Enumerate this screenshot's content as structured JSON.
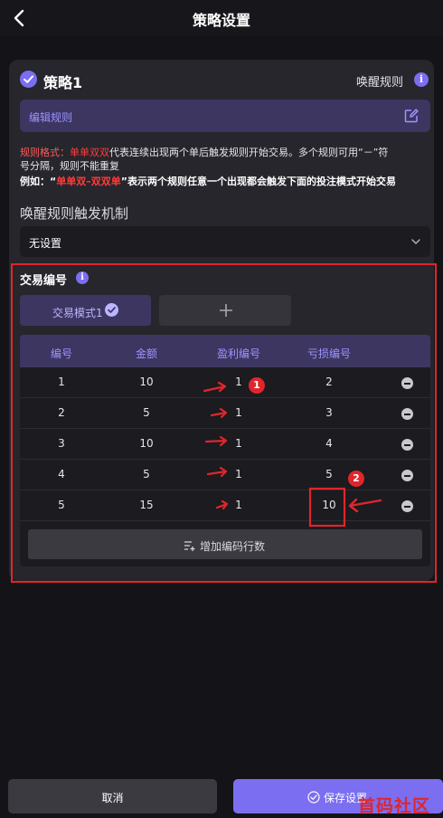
{
  "header": {
    "title": "策略设置",
    "back_icon": "chevron-left-icon"
  },
  "strategy": {
    "name": "策略1",
    "wake_rule_label": "唤醒规则",
    "info_icon": "i",
    "edit_rule_label": "编辑规则"
  },
  "hint": {
    "label": "规则格式：",
    "example_red": "单单双双",
    "line1_rest": "代表连续出现两个单后触发规则开始交易。多个规则可用“－”符",
    "line2": "号分隔，规则不能重复",
    "line3_prefix": "例如：“",
    "line3_red": "单单双–双双单",
    "line3_rest": "”表示两个规则任意一个出现都会触发下面的投注模式开始交易"
  },
  "trigger": {
    "title": "唤醒规则触发机制",
    "selected": "无设置"
  },
  "trade": {
    "title": "交易编号",
    "info_icon": "i",
    "mode_tab_label": "交易模式1",
    "columns": [
      "编号",
      "金额",
      "盈利编号",
      "亏损编号"
    ],
    "rows": [
      {
        "id": "1",
        "amount": "10",
        "profit": "1",
        "loss": "2"
      },
      {
        "id": "2",
        "amount": "5",
        "profit": "1",
        "loss": "3"
      },
      {
        "id": "3",
        "amount": "10",
        "profit": "1",
        "loss": "4"
      },
      {
        "id": "4",
        "amount": "5",
        "profit": "1",
        "loss": "5"
      },
      {
        "id": "5",
        "amount": "15",
        "profit": "1",
        "loss": "10"
      }
    ],
    "add_rows_label": "增加编码行数"
  },
  "annotations": {
    "badge1": "1",
    "badge2": "2",
    "color": "#e0262b"
  },
  "footer": {
    "cancel_label": "取消",
    "save_label": "保存设置"
  },
  "watermark": "首码社区",
  "colors": {
    "accent": "#7b6ef0",
    "background": "#141418",
    "card": "#26262c",
    "annotation_red": "#e0262b"
  }
}
